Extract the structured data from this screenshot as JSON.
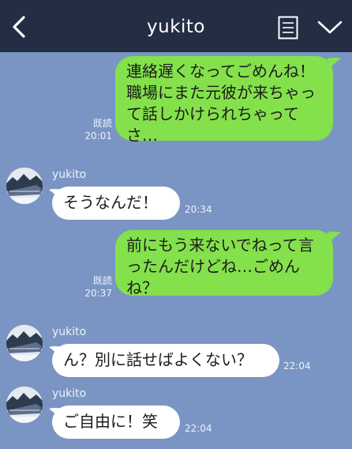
{
  "header": {
    "title": "yukito"
  },
  "colors": {
    "header_bg": "#232d44",
    "chat_bg": "#7a95c4",
    "my_bubble": "#84e14b",
    "their_bubble": "#ffffff"
  },
  "messages": [
    {
      "from": "me",
      "text": "連絡遅くなってごめんね！職場にまた元彼が来ちゃって話しかけられちゃってさ…",
      "read": "既読",
      "time": "20:01"
    },
    {
      "from": "yukito",
      "sender": "yukito",
      "text": "そうなんだ！",
      "time": "20:34"
    },
    {
      "from": "me",
      "text": "前にもう来ないでねって言ったんだけどね…ごめんね？",
      "read": "既読",
      "time": "20:37"
    },
    {
      "from": "yukito",
      "sender": "yukito",
      "text": "ん？別に話せばよくない？",
      "time": "22:04"
    },
    {
      "from": "yukito",
      "sender": "yukito",
      "text": "ご自由に！笑",
      "time": "22:04"
    }
  ],
  "icons": {
    "back": "chevron-left-icon",
    "menu": "list-icon",
    "collapse": "chevron-down-icon",
    "avatar": "train-avatar-icon"
  }
}
